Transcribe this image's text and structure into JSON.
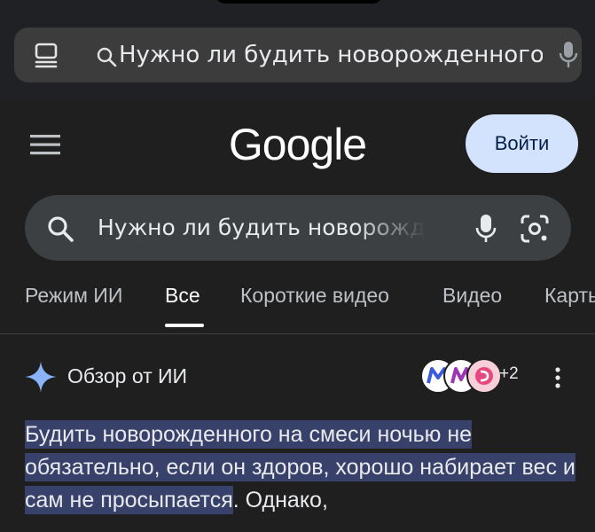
{
  "browser": {
    "url_text": "Нужно ли будить новорожденного"
  },
  "header": {
    "logo_text": "Google",
    "signin_label": "Войти"
  },
  "search": {
    "query": "Нужно ли будить новорожденного"
  },
  "tabs": [
    {
      "label": "Режим ИИ",
      "active": false
    },
    {
      "label": "Все",
      "active": true
    },
    {
      "label": "Короткие видео",
      "active": false
    },
    {
      "label": "Видео",
      "active": false
    },
    {
      "label": "Карты",
      "active": false
    }
  ],
  "ai_overview": {
    "title": "Обзор от ИИ",
    "sources_more": "+2",
    "highlighted_text": "Будить новорожденного на смеси ночью не обязательно, если он здоров, хорошо набирает вес и сам не просыпается",
    "following_text": ". Однако,"
  },
  "colors": {
    "background": "#1f1f1f",
    "signin_bg": "#d3e3fd",
    "highlight": "#38416a"
  },
  "icons": [
    "tabs-icon",
    "search-icon",
    "mic-icon",
    "menu-icon",
    "lens-icon",
    "sparkle-icon",
    "more-vert-icon"
  ]
}
